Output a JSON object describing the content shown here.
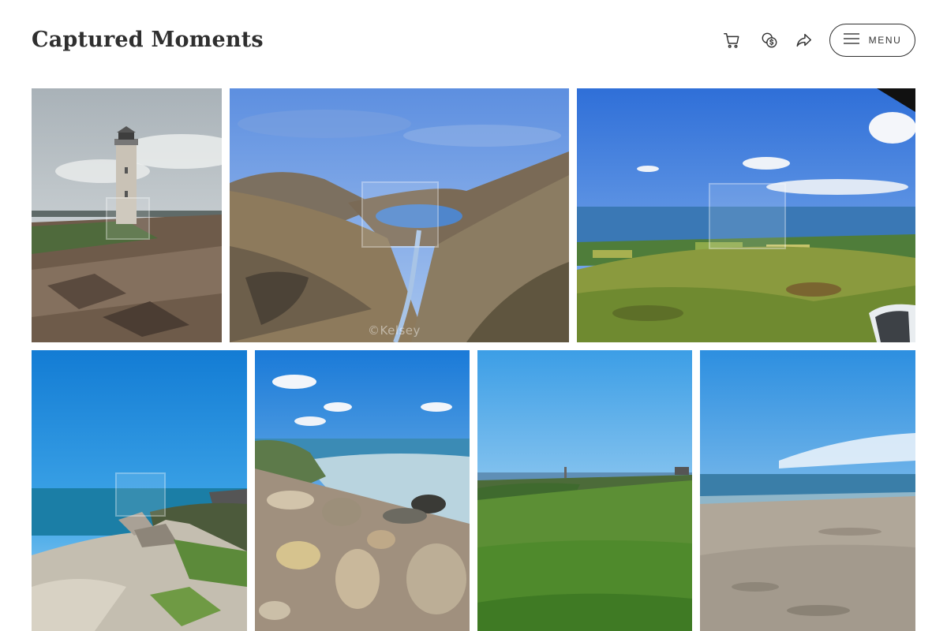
{
  "site": {
    "title": "Captured Moments"
  },
  "header": {
    "icons": [
      "cart-icon",
      "currency-exchange-icon",
      "share-icon",
      "hamburger-icon"
    ],
    "menu_label": "MENU"
  },
  "colors": {
    "text": "#2f2f2f",
    "background": "#ffffff"
  },
  "gallery": {
    "watermark_text": "©Kelsey",
    "photos": [
      {
        "subject": "lighthouse on rocky shore"
      },
      {
        "subject": "valley stream and mountain lake"
      },
      {
        "subject": "coastal hills and sea view"
      },
      {
        "subject": "limestone cliff and blue sea"
      },
      {
        "subject": "pebble beach with boulders"
      },
      {
        "subject": "grassy clifftop with distant lighthouse"
      },
      {
        "subject": "sandy beach with footprints"
      }
    ]
  }
}
